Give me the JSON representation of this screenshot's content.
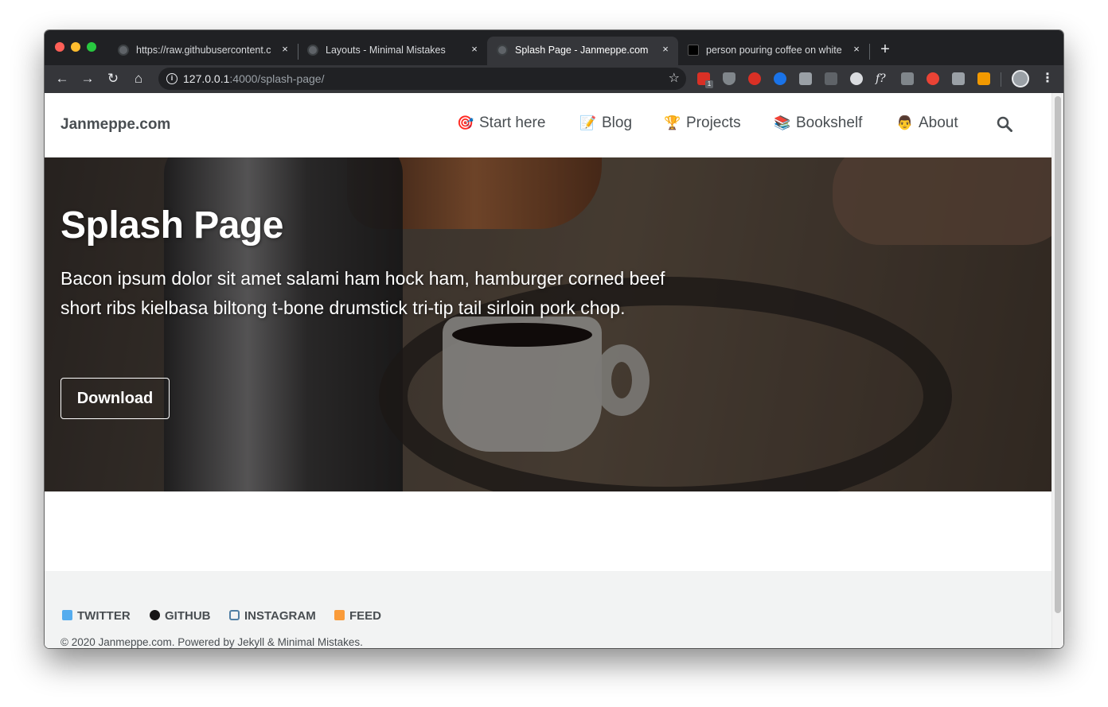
{
  "browser": {
    "tabs": [
      {
        "title": "https://raw.githubusercontent.c",
        "active": false
      },
      {
        "title": "Layouts - Minimal Mistakes",
        "active": false
      },
      {
        "title": "Splash Page - Janmeppe.com",
        "active": true
      },
      {
        "title": "person pouring coffee on white",
        "active": false
      }
    ],
    "new_tab_label": "+",
    "close_label": "×",
    "url_host": "127.0.0.1",
    "url_path": ":4000/splash-page/",
    "star_label": "☆",
    "info_label": "i",
    "back_label": "←",
    "forward_label": "→",
    "reload_label": "↻",
    "home_label": "⌂",
    "menu_label": "⋮",
    "extension_badge": "1"
  },
  "site": {
    "title": "Janmeppe.com",
    "nav": [
      {
        "emoji": "🎯",
        "label": "Start here"
      },
      {
        "emoji": "📝",
        "label": "Blog"
      },
      {
        "emoji": "🏆",
        "label": "Projects"
      },
      {
        "emoji": "📚",
        "label": "Bookshelf"
      },
      {
        "emoji": "👨",
        "label": "About"
      }
    ]
  },
  "hero": {
    "title": "Splash Page",
    "excerpt": "Bacon ipsum dolor sit amet salami ham hock ham, hamburger corned beef short ribs kielbasa biltong t-bone drumstick tri-tip tail sirloin pork chop.",
    "button_label": "Download"
  },
  "footer": {
    "links": [
      {
        "label": "TWITTER",
        "icon": "twitter-icon",
        "color": "#55acee"
      },
      {
        "label": "GITHUB",
        "icon": "github-icon",
        "color": "#171516"
      },
      {
        "label": "INSTAGRAM",
        "icon": "instagram-icon",
        "color": "#517fa4"
      },
      {
        "label": "FEED",
        "icon": "rss-icon",
        "color": "#fa9b39"
      }
    ],
    "copyright": "© 2020 Janmeppe.com. Powered by Jekyll & Minimal Mistakes."
  }
}
